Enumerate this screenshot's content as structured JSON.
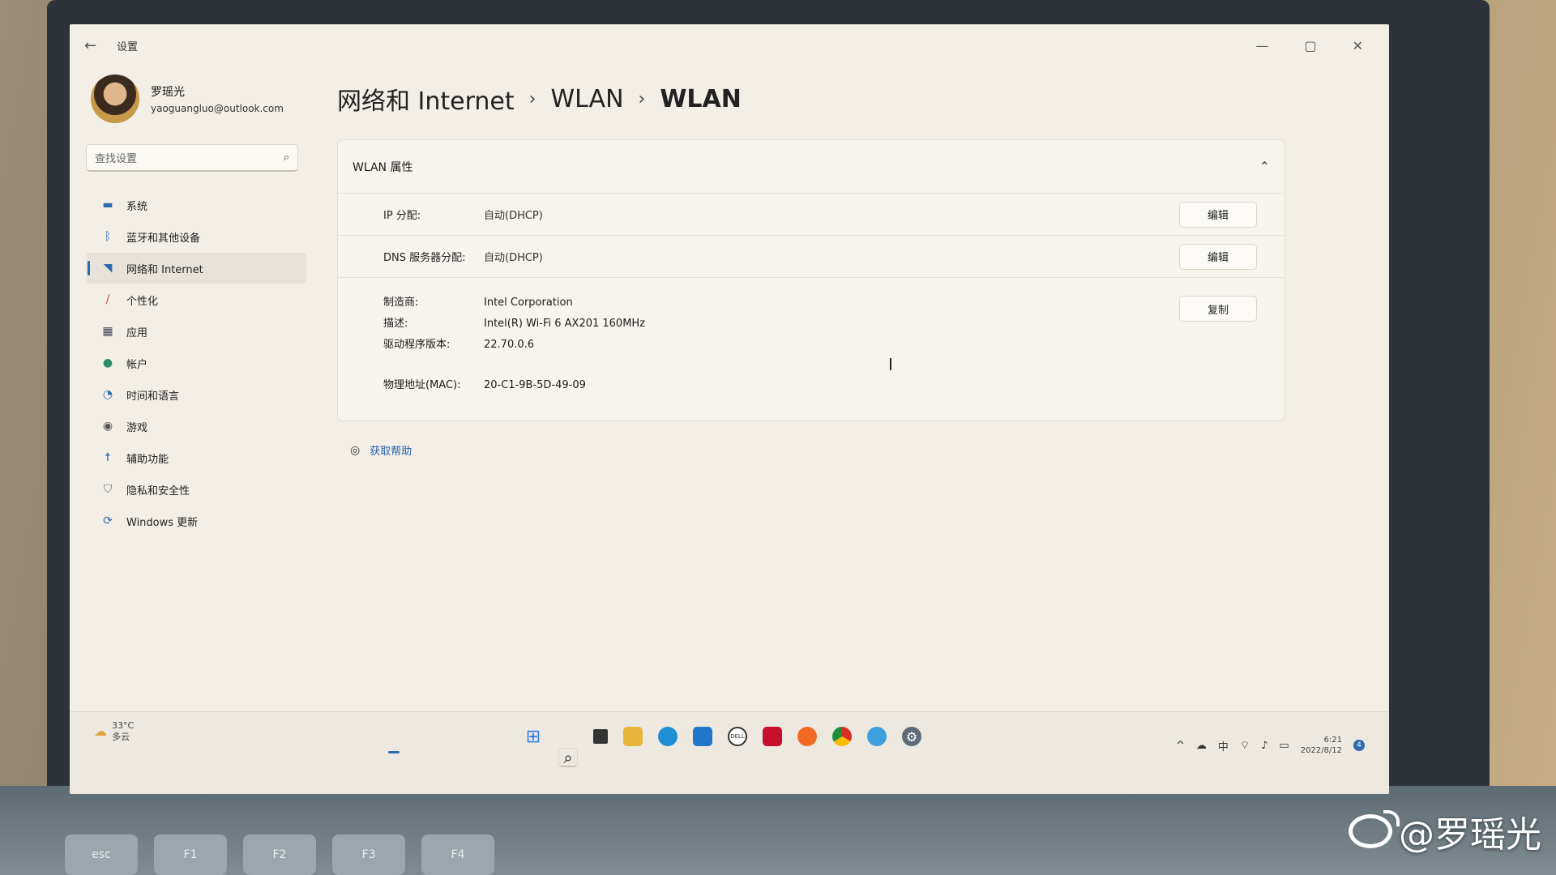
{
  "window": {
    "title": "设置",
    "controls": {
      "minimize": "—",
      "maximize": "▢",
      "close": "✕"
    }
  },
  "profile": {
    "name": "罗瑶光",
    "email": "yaoguangluo@outlook.com"
  },
  "search": {
    "placeholder": "查找设置"
  },
  "nav": {
    "items": [
      {
        "label": "系统",
        "icon": "display-icon"
      },
      {
        "label": "蓝牙和其他设备",
        "icon": "bluetooth-icon"
      },
      {
        "label": "网络和 Internet",
        "icon": "wifi-icon",
        "active": true
      },
      {
        "label": "个性化",
        "icon": "brush-icon"
      },
      {
        "label": "应用",
        "icon": "apps-icon"
      },
      {
        "label": "帐户",
        "icon": "person-icon"
      },
      {
        "label": "时间和语言",
        "icon": "globe-clock-icon"
      },
      {
        "label": "游戏",
        "icon": "gamepad-icon"
      },
      {
        "label": "辅助功能",
        "icon": "accessibility-icon"
      },
      {
        "label": "隐私和安全性",
        "icon": "shield-icon"
      },
      {
        "label": "Windows 更新",
        "icon": "update-icon"
      }
    ]
  },
  "breadcrumb": {
    "part1": "网络和 Internet",
    "sep": "›",
    "part2": "WLAN",
    "current": "WLAN"
  },
  "card": {
    "title": "WLAN 属性",
    "ip": {
      "label": "IP 分配:",
      "value": "自动(DHCP)",
      "button": "编辑"
    },
    "dns": {
      "label": "DNS 服务器分配:",
      "value": "自动(DHCP)",
      "button": "编辑"
    },
    "copy_button": "复制",
    "manufacturer": {
      "label": "制造商:",
      "value": "Intel Corporation"
    },
    "description": {
      "label": "描述:",
      "value": "Intel(R) Wi-Fi 6 AX201 160MHz"
    },
    "driver": {
      "label": "驱动程序版本:",
      "value": "22.70.0.6"
    },
    "mac": {
      "label": "物理地址(MAC):",
      "value": "20-C1-9B-5D-49-09"
    }
  },
  "help": {
    "label": "获取帮助"
  },
  "taskbar": {
    "weather_temp": "33°C",
    "weather_desc": "多云",
    "ime": "中",
    "time": "6:21",
    "date": "2022/8/12",
    "notifications": "4"
  },
  "keyboard": {
    "keys": [
      "esc",
      "F1",
      "F2",
      "F3",
      "F4"
    ]
  },
  "watermark": "@罗瑶光",
  "colors": {
    "accent": "#2b6cb0",
    "link": "#2662a8",
    "window_bg": "#f3efe7"
  }
}
